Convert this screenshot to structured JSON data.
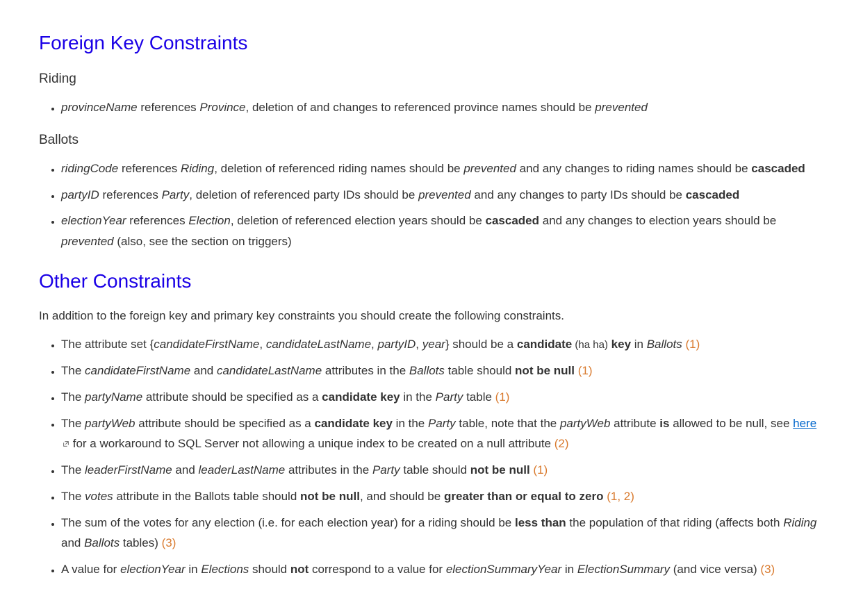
{
  "headings": {
    "foreignKey": "Foreign Key Constraints",
    "other": "Other Constraints"
  },
  "subheadings": {
    "riding": "Riding",
    "ballots": "Ballots"
  },
  "intro": "In addition to the foreign key and primary key constraints you should create the following constraints.",
  "riding": {
    "item1": {
      "em1": "provinceName",
      "t1": " references ",
      "em2": "Province",
      "t2": ", deletion of and changes to referenced province names should be ",
      "em3": "prevented"
    }
  },
  "ballots": {
    "item1": {
      "em1": "ridingCode",
      "t1": " references ",
      "em2": "Riding",
      "t2": ", deletion of referenced riding names should be ",
      "em3": "prevented",
      "t3": " and any changes to riding names should be ",
      "strong1": "cascaded"
    },
    "item2": {
      "em1": "partyID",
      "t1": " references ",
      "em2": "Party",
      "t2": ", deletion of referenced party IDs should be ",
      "em3": "prevented",
      "t3": " and any changes to party IDs should be ",
      "strong1": "cascaded"
    },
    "item3": {
      "em1": "electionYear",
      "t1": " references ",
      "em2": "Election",
      "t2": ", deletion of referenced election years should be ",
      "strong1": "cascaded",
      "t3": " and any changes to election years should be ",
      "em3": "prevented",
      "t4": " (also, see the section on triggers)"
    }
  },
  "constraints": {
    "item1": {
      "t1": "The attribute set {",
      "em1": "candidateFirstName",
      "t2": ", ",
      "em2": "candidateLastName",
      "t3": ", ",
      "em3": "partyID",
      "t4": ", ",
      "em4": "year",
      "t5": "} should be a ",
      "strong1": "candidate",
      "small1": " (",
      "small2": "ha ha",
      "small3": ")",
      "strong2": " key",
      "t6": " in ",
      "em5": "Ballots",
      "note": " (1)"
    },
    "item2": {
      "t1": "The ",
      "em1": "candidateFirstName",
      "t2": " and ",
      "em2": "candidateLastName",
      "t3": " attributes in the ",
      "em3": "Ballots",
      "t4": " table should ",
      "strong1": "not be null",
      "note": " (1)"
    },
    "item3": {
      "t1": "The  ",
      "em1": "partyName",
      "t2": " attribute should be specified as a ",
      "strong1": "candidate key",
      "t3": " in the ",
      "em2": "Party",
      "t4": " table",
      "note": " (1)"
    },
    "item4": {
      "t1": "The  ",
      "em1": "partyWeb",
      "t2": " attribute should be specified as a ",
      "strong1": "candidate key",
      "t3": " in the ",
      "em2": "Party",
      "t4": " table, note that the ",
      "em3": "partyWeb",
      "t5": " attribute ",
      "strong2": "is",
      "t6": " allowed to be null, see ",
      "link": "here",
      "t7": "  for a workaround to SQL Server not allowing a unique index to be created on a null attribute",
      "note": " (2)"
    },
    "item5": {
      "t1": "The ",
      "em1": "leaderFirstName",
      "t2": " and ",
      "em2": "leaderLastName",
      "t3": " attributes in the ",
      "em3": "Party",
      "t4": " table should ",
      "strong1": "not be null",
      "note": " (1)"
    },
    "item6": {
      "t1": "The ",
      "em1": "votes",
      "t2": " attribute in the Ballots table should ",
      "strong1": "not be null",
      "t3": ", and should be ",
      "strong2": "greater than or equal to zero",
      "note": " (1, 2)"
    },
    "item7": {
      "t1": "The sum of the votes for any election (i.e. for each election year) for a riding should be ",
      "strong1": "less than",
      "t2": " the population of that riding (affects both ",
      "em1": "Riding",
      "t3": " and ",
      "em2": "Ballots",
      "t4": " tables)",
      "note": " (3)"
    },
    "item8": {
      "t1": "A value for ",
      "em1": "electionYear",
      "t2": " in ",
      "em2": "Elections",
      "t3": " should ",
      "strong1": "not",
      "t4": " correspond to a value for ",
      "em3": "electionSummaryYear",
      "t5": " in ",
      "em4": "ElectionSummary",
      "t6": " (and vice versa)",
      "note": " (3)"
    }
  }
}
